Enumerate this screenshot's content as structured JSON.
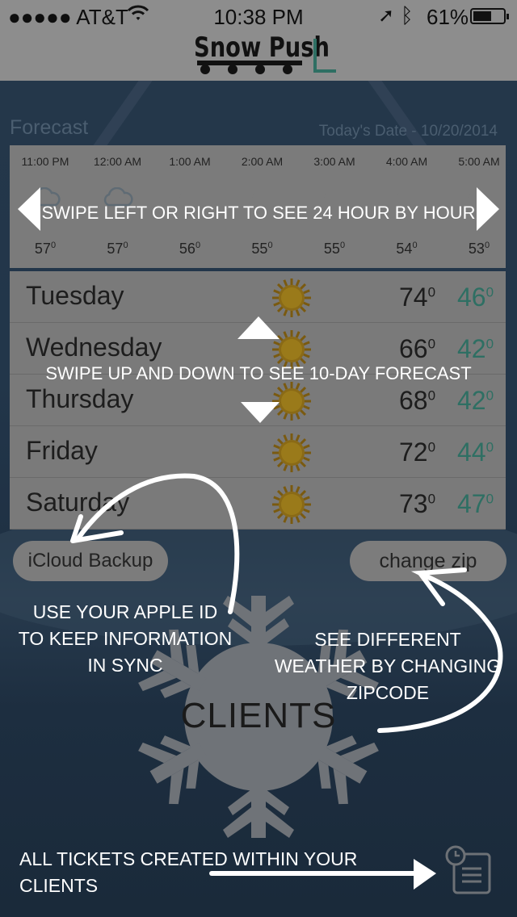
{
  "status_bar": {
    "carrier": "●●●●● AT&T",
    "time": "10:38 PM",
    "battery": "61%",
    "battery_level": 0.61
  },
  "app": {
    "logo": "Snow Push"
  },
  "forecast": {
    "title": "Forecast",
    "today_date": "Today's Date - 10/20/2014",
    "hourly": [
      {
        "time": "11:00 PM",
        "temp": "57",
        "icon": "cloud-icon"
      },
      {
        "time": "12:00 AM",
        "temp": "57",
        "icon": "cloud-icon"
      },
      {
        "time": "1:00 AM",
        "temp": "56",
        "icon": "moon-icon"
      },
      {
        "time": "2:00 AM",
        "temp": "55",
        "icon": "moon-icon"
      },
      {
        "time": "3:00 AM",
        "temp": "55",
        "icon": "moon-icon"
      },
      {
        "time": "4:00 AM",
        "temp": "54",
        "icon": "moon-icon"
      },
      {
        "time": "5:00 AM",
        "temp": "53",
        "icon": "moon-icon"
      }
    ],
    "daily": [
      {
        "day": "Tuesday",
        "high": "74",
        "low": "46",
        "icon": "sun-icon"
      },
      {
        "day": "Wednesday",
        "high": "66",
        "low": "42",
        "icon": "sun-icon"
      },
      {
        "day": "Thursday",
        "high": "68",
        "low": "42",
        "icon": "sun-icon"
      },
      {
        "day": "Friday",
        "high": "72",
        "low": "44",
        "icon": "sun-icon"
      },
      {
        "day": "Saturday",
        "high": "73",
        "low": "47",
        "icon": "sun-icon"
      }
    ],
    "degree": "0"
  },
  "buttons": {
    "icloud": "iCloud Backup",
    "zip": "change zip",
    "clients": "CLIENTS"
  },
  "overlay": {
    "hourly_hint": "SWIPE LEFT OR RIGHT TO SEE 24 HOUR BY HOUR",
    "daily_hint": "SWIPE UP AND DOWN TO SEE 10-DAY FORECAST",
    "icloud_hint_1": "USE YOUR APPLE ID",
    "icloud_hint_2": "TO KEEP INFORMATION",
    "icloud_hint_3": "IN SYNC",
    "zip_hint_1": "SEE DIFFERENT",
    "zip_hint_2": "WEATHER BY CHANGING",
    "zip_hint_3": "ZIPCODE",
    "tickets_hint": "ALL TICKETS CREATED WITHIN YOUR CLIENTS"
  },
  "colors": {
    "low_temp": "#2e6f63",
    "panel": "#7a7a7a",
    "overlay_text": "#ffffff"
  }
}
